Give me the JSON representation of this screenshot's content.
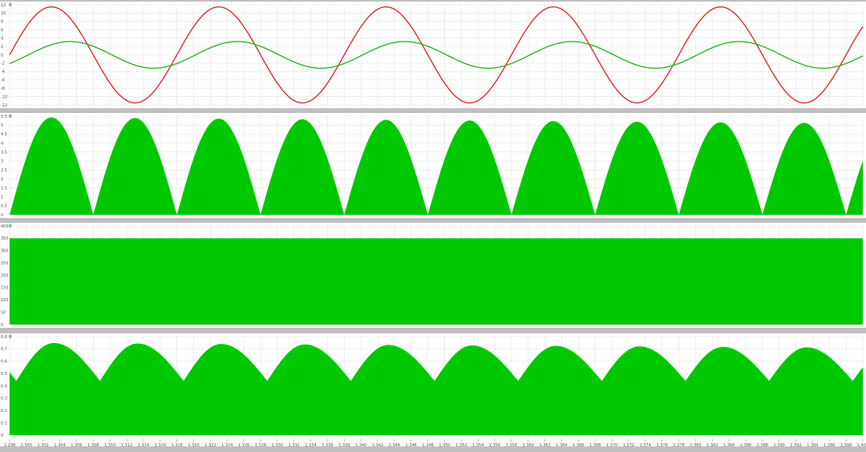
{
  "scope": {
    "panels": [
      {
        "id": "p1",
        "marker": "0"
      },
      {
        "id": "p2",
        "marker": "0"
      },
      {
        "id": "p3",
        "marker": "0"
      },
      {
        "id": "p4",
        "marker": "0"
      }
    ]
  },
  "chart_data": [
    {
      "type": "line",
      "title": "",
      "xlabel": "",
      "ylabel": "",
      "xlim": [
        1.298,
        1.4
      ],
      "ylim": [
        -12,
        12
      ],
      "y_ticks": [
        -12,
        -10,
        -8,
        -6,
        -4,
        -2,
        0,
        2,
        4,
        6,
        8,
        10,
        12
      ],
      "grid": true,
      "series": [
        {
          "color": "#e02020",
          "form": "sine",
          "amplitude": 11.5,
          "frequency_hz": 50,
          "phase_deg": 0,
          "x_start": 1.298,
          "x_end": 1.4
        },
        {
          "color": "#20b020",
          "form": "sine",
          "amplitude": 3.2,
          "frequency_hz": 50,
          "phase_deg": -40,
          "x_start": 1.298,
          "x_end": 1.4
        }
      ]
    },
    {
      "type": "area",
      "title": "",
      "xlabel": "",
      "ylabel": "",
      "xlim": [
        1.298,
        1.4
      ],
      "ylim": [
        0,
        5.5
      ],
      "y_ticks": [
        0,
        0.5,
        1,
        1.5,
        2,
        2.5,
        3,
        3.5,
        4,
        4.5,
        5,
        5.5
      ],
      "grid": true,
      "series": [
        {
          "color": "#00c800",
          "form": "rectified-sine envelope",
          "peak_start": 5.45,
          "peak_end": 5.1,
          "frequency_hz": 100
        }
      ]
    },
    {
      "type": "area",
      "title": "",
      "xlabel": "",
      "ylabel": "",
      "xlim": [
        1.298,
        1.4
      ],
      "ylim": [
        0,
        400
      ],
      "y_ticks": [
        0,
        50,
        100,
        150,
        200,
        250,
        300,
        350,
        400
      ],
      "grid": true,
      "series": [
        {
          "color": "#00c800",
          "form": "switching waveform",
          "high": 350,
          "low": 0
        }
      ]
    },
    {
      "type": "area",
      "title": "",
      "xlabel": "",
      "ylabel": "",
      "xlim": [
        1.298,
        1.4
      ],
      "ylim": [
        0,
        0.8
      ],
      "y_ticks": [
        0,
        0.1,
        0.2,
        0.3,
        0.4,
        0.5,
        0.6,
        0.7,
        0.8
      ],
      "grid": true,
      "series": [
        {
          "color": "#00c800",
          "form": "ripple envelope",
          "base": 0.44,
          "peak_start": 0.75,
          "peak_end": 0.71,
          "frequency_hz": 100
        }
      ]
    }
  ],
  "time_axis": {
    "ticks": [
      "1.298",
      "1.300",
      "1.302",
      "1.304",
      "1.306",
      "1.308",
      "1.310",
      "1.312",
      "1.314",
      "1.316",
      "1.318",
      "1.320",
      "1.322",
      "1.324",
      "1.326",
      "1.328",
      "1.330",
      "1.332",
      "1.334",
      "1.336",
      "1.338",
      "1.340",
      "1.342",
      "1.344",
      "1.346",
      "1.348",
      "1.350",
      "1.352",
      "1.354",
      "1.356",
      "1.358",
      "1.360",
      "1.362",
      "1.364",
      "1.366",
      "1.368",
      "1.370",
      "1.372",
      "1.374",
      "1.376",
      "1.378",
      "1.380",
      "1.382",
      "1.384",
      "1.386",
      "1.388",
      "1.390",
      "1.392",
      "1.394",
      "1.396",
      "1.398",
      "1.400"
    ]
  },
  "colors": {
    "background": "#c0c0c0",
    "panel": "#ffffff",
    "grid": "#e4e4e4",
    "red": "#e02020",
    "green": "#20b020",
    "fill": "#00c800"
  }
}
